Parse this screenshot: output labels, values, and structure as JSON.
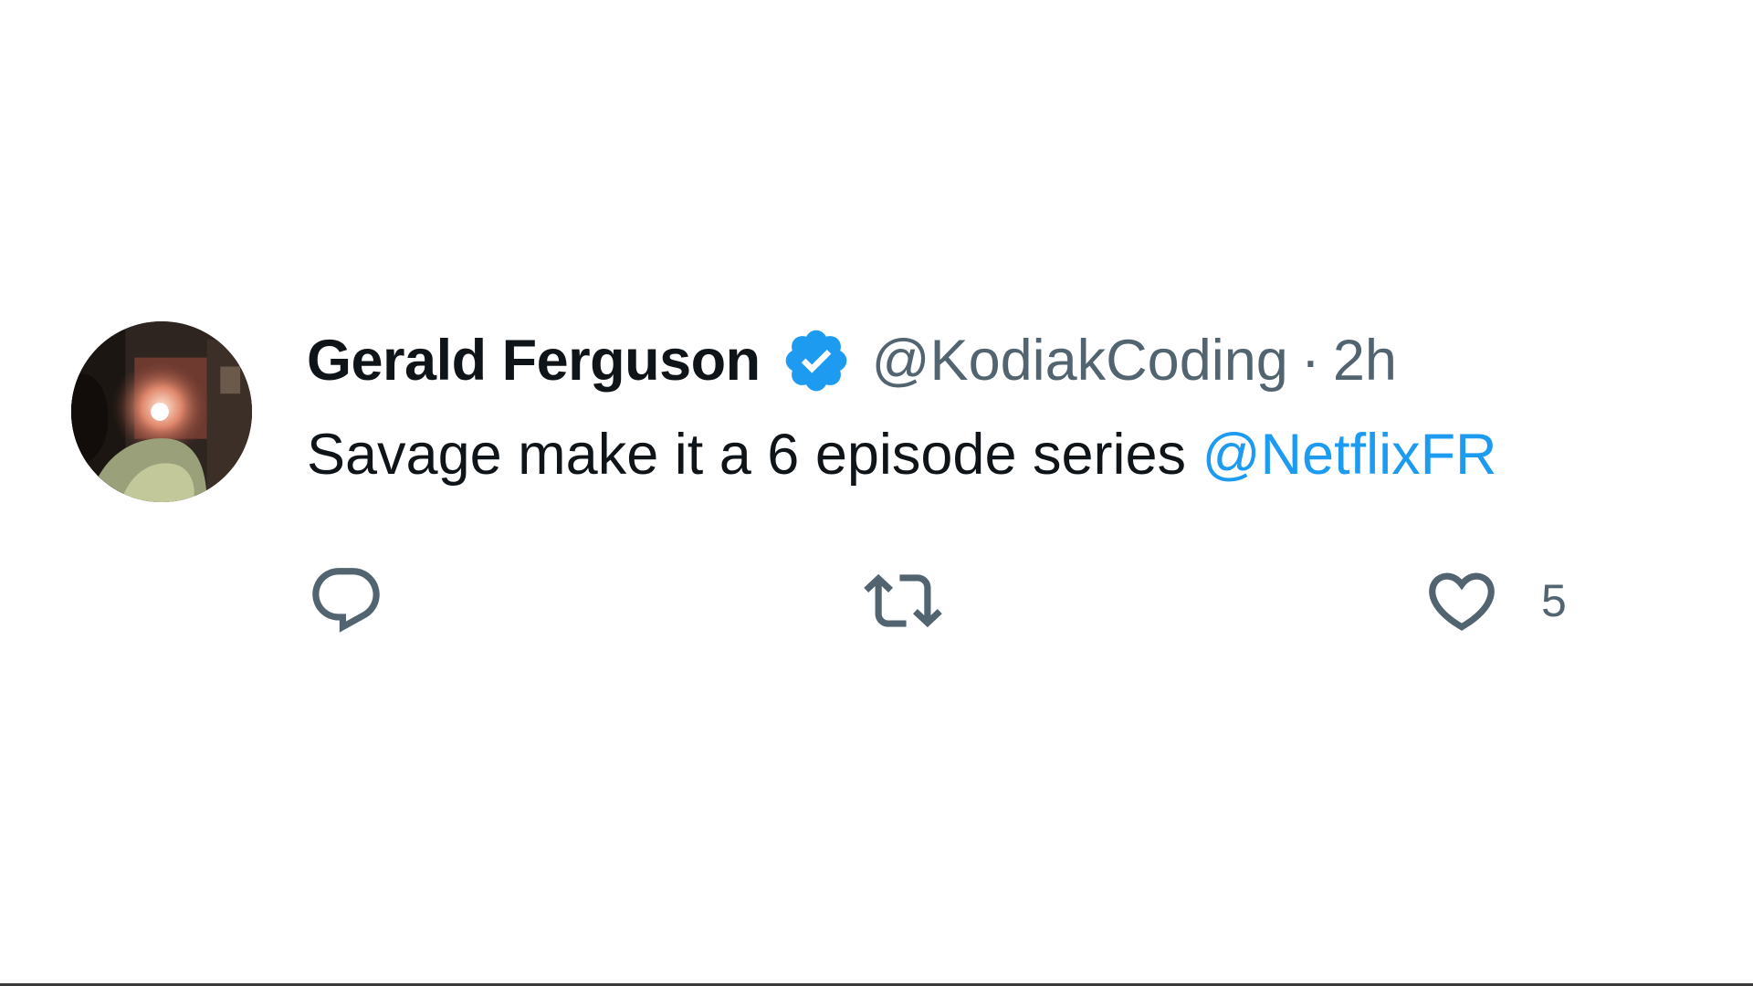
{
  "tweet": {
    "author": {
      "display_name": "Gerald Ferguson",
      "handle": "@KodiakCoding",
      "verified": true,
      "avatar_icon": "profile-photo"
    },
    "separator": "·",
    "time_ago": "2h",
    "text": "Savage make it a 6 episode series",
    "mention": "@NetflixFR",
    "actions": {
      "reply_icon": "speech-bubble-icon",
      "repost_icon": "repost-arrows-icon",
      "like_icon": "heart-icon",
      "like_count": "5"
    }
  },
  "colors": {
    "text_primary": "#0f1419",
    "text_secondary": "#536471",
    "accent": "#1d9bf0"
  }
}
